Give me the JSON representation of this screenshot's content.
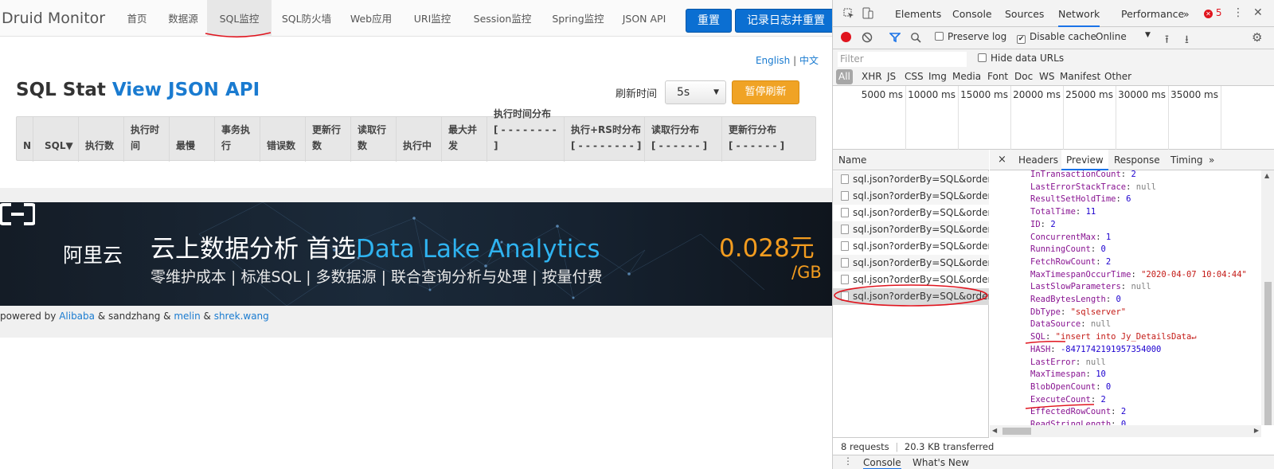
{
  "druid": {
    "brand": "Druid Monitor",
    "nav": [
      "首页",
      "数据源",
      "SQL监控",
      "SQL防火墙",
      "Web应用",
      "URI监控",
      "Session监控",
      "Spring监控",
      "JSON API"
    ],
    "active_nav": "SQL监控",
    "reset_button": "重置",
    "log_reset_button": "记录日志并重置",
    "lang_en": "English",
    "lang_sep": "|",
    "lang_zh": "中文",
    "title_prefix": "SQL Stat",
    "title_link": "View JSON API",
    "refresh_label": "刷新时间",
    "refresh_value": "5s",
    "pause_button": "暂停刷新",
    "table_headers": [
      [
        "N"
      ],
      [
        "SQL▼"
      ],
      [
        "执行数"
      ],
      [
        "执行时",
        "间"
      ],
      [
        "最慢"
      ],
      [
        "事务执",
        "行"
      ],
      [
        "错误数"
      ],
      [
        "更新行",
        "数"
      ],
      [
        "读取行",
        "数"
      ],
      [
        "执行中"
      ],
      [
        "最大并",
        "发"
      ],
      [
        "执行时间分布",
        "[ - - - - - - - - ]"
      ],
      [
        "执行+RS时分布",
        "[ - - - - - - - - ]"
      ],
      [
        "读取行分布",
        "[ - - - - - - ]"
      ],
      [
        "更新行分布",
        "[ - - - - - - ]"
      ]
    ],
    "banner": {
      "logo_text": "阿里云",
      "headline_main": "云上数据分析 首选",
      "headline_highlight": "Data Lake Analytics",
      "subline": "零维护成本 | 标准SQL | 多数据源 | 联合查询分析与处理 | 按量付费",
      "price": "0.028元",
      "unit": "/GB"
    },
    "footer": {
      "prefix": "powered by",
      "link1": "Alibaba",
      "mid1": "& sandzhang &",
      "link2": "melin",
      "mid2": "&",
      "link3": "shrek.wang"
    }
  },
  "devtools": {
    "tabs": [
      "Elements",
      "Console",
      "Sources",
      "Network",
      "Performance",
      "»"
    ],
    "active_tab": "Network",
    "error_count": "5",
    "toolbar": {
      "preserve_log": "Preserve log",
      "disable_cache": "Disable cache",
      "throttle": "Online"
    },
    "filter_placeholder": "Filter",
    "hide_data_urls": "Hide data URLs",
    "types": [
      "All",
      "XHR",
      "JS",
      "CSS",
      "Img",
      "Media",
      "Font",
      "Doc",
      "WS",
      "Manifest",
      "Other"
    ],
    "timeline_ticks": [
      "5000 ms",
      "10000 ms",
      "15000 ms",
      "20000 ms",
      "25000 ms",
      "30000 ms",
      "35000 ms"
    ],
    "name_header": "Name",
    "requests": [
      "sql.json?orderBy=SQL&orderT...",
      "sql.json?orderBy=SQL&orderT...",
      "sql.json?orderBy=SQL&orderT...",
      "sql.json?orderBy=SQL&orderT...",
      "sql.json?orderBy=SQL&orderT...",
      "sql.json?orderBy=SQL&orderT...",
      "sql.json?orderBy=SQL&orderT...",
      "sql.json?orderBy=SQL&orderT..."
    ],
    "selected_request_index": 7,
    "preview_tabs": [
      "×",
      "Headers",
      "Preview",
      "Response",
      "Timing",
      "»"
    ],
    "active_preview_tab": "Preview",
    "preview": [
      {
        "k": "InTransactionCount",
        "v": "2",
        "t": "num"
      },
      {
        "k": "LastErrorStackTrace",
        "v": "null",
        "t": "null"
      },
      {
        "k": "ResultSetHoldTime",
        "v": "6",
        "t": "num"
      },
      {
        "k": "TotalTime",
        "v": "11",
        "t": "num"
      },
      {
        "k": "ID",
        "v": "2",
        "t": "num"
      },
      {
        "k": "ConcurrentMax",
        "v": "1",
        "t": "num"
      },
      {
        "k": "RunningCount",
        "v": "0",
        "t": "num"
      },
      {
        "k": "FetchRowCount",
        "v": "2",
        "t": "num"
      },
      {
        "k": "MaxTimespanOccurTime",
        "v": "\"2020-04-07 10:04:44\"",
        "t": "str"
      },
      {
        "k": "LastSlowParameters",
        "v": "null",
        "t": "null"
      },
      {
        "k": "ReadBytesLength",
        "v": "0",
        "t": "num"
      },
      {
        "k": "DbType",
        "v": "\"sqlserver\"",
        "t": "str"
      },
      {
        "k": "DataSource",
        "v": "null",
        "t": "null"
      },
      {
        "k": "SQL",
        "v": "\"insert into Jy_DetailsData↵",
        "t": "str"
      },
      {
        "k": "HASH",
        "v": "-8471742191957354000",
        "t": "num"
      },
      {
        "k": "LastError",
        "v": "null",
        "t": "null"
      },
      {
        "k": "MaxTimespan",
        "v": "10",
        "t": "num"
      },
      {
        "k": "BlobOpenCount",
        "v": "0",
        "t": "num"
      },
      {
        "k": "ExecuteCount",
        "v": "2",
        "t": "num"
      },
      {
        "k": "EffectedRowCount",
        "v": "2",
        "t": "num"
      },
      {
        "k": "ReadStringLength",
        "v": "0",
        "t": "num"
      }
    ],
    "status": {
      "requests": "8 requests",
      "sep": "|",
      "transferred": "20.3 KB transferred"
    },
    "drawer_tabs": [
      "Console",
      "What's New"
    ],
    "active_drawer_tab": "Console"
  },
  "colors": {
    "druid_blue": "#0b6fd2",
    "druid_orange": "#f0a325",
    "link_blue": "#1a7bd0",
    "annotation_red": "#e0141e",
    "devtools_accent": "#1a73e8"
  }
}
